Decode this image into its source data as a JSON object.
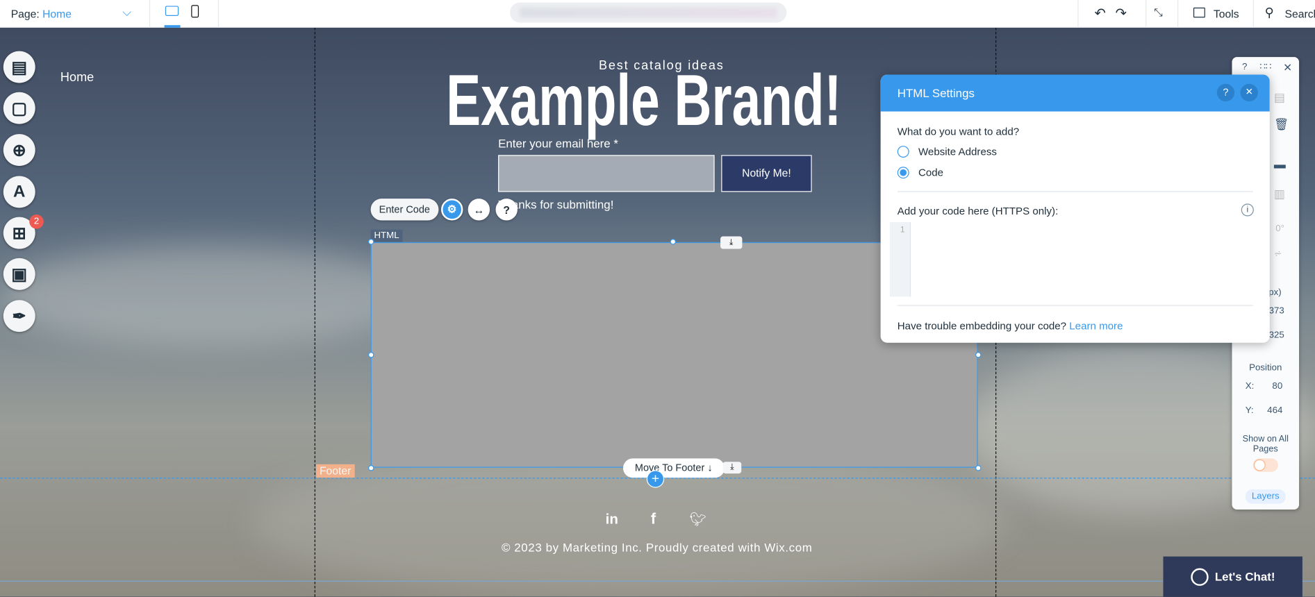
{
  "topbar": {
    "page_label": "Page:",
    "page_value": "Home",
    "tools": "Tools",
    "search": "Search"
  },
  "site": {
    "nav_home": "Home",
    "tagline": "Best catalog ideas",
    "brand": "Example Brand!",
    "email_label": "Enter your email here *",
    "notify": "Notify Me!",
    "thanks": "Thanks for submitting!",
    "footer_tag": "Footer",
    "copyright": "© 2023 by Marketing Inc. Proudly created with Wix.com",
    "chat": "Let's Chat!"
  },
  "left_toolbar": {
    "badge": "2"
  },
  "element": {
    "tag": "HTML",
    "enter_code": "Enter Code",
    "move_to_footer": "Move To Footer"
  },
  "dialog": {
    "title": "HTML Settings",
    "question": "What do you want to add?",
    "options": [
      "Website Address",
      "Code"
    ],
    "selected": "Code",
    "code_label": "Add your code here (HTTPS only):",
    "line_number": "1",
    "help_text": "Have trouble embedding your code?",
    "learn_more": "Learn more"
  },
  "right_panel": {
    "rotation": "0°",
    "size_label": "(px)",
    "width": "373",
    "height": "325",
    "position_label": "Position",
    "x_label": "X:",
    "x": "80",
    "y_label": "Y:",
    "y": "464",
    "show_all": "Show on All Pages",
    "show_all_on": false,
    "layers": "Layers"
  },
  "colors": {
    "accent": "#3899ec",
    "dark_button": "#2b3a67",
    "footer_tag": "#fcb48a"
  }
}
